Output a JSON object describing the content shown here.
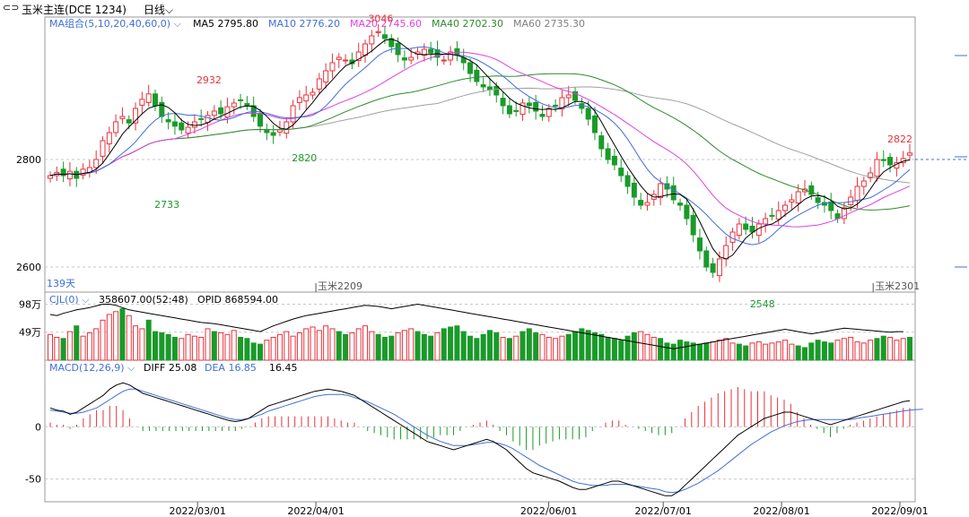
{
  "header": {
    "compare_icon": "compare-icon",
    "symbol": "玉米主连(DCE 1234)",
    "period": "日线",
    "period_chevron": "chevron-down-icon"
  },
  "colors": {
    "up": "#e8323c",
    "down": "#1a9a2a",
    "ma5": "#000000",
    "ma10": "#3f6fd8",
    "ma20": "#e040e0",
    "ma40": "#2e8b2e",
    "ma60": "#a0a0a0",
    "diff": "#000000",
    "dea": "#3f6fd8"
  },
  "chart_data": [
    {
      "type": "candlestick",
      "indicator": {
        "label": "MA组合(5,10,20,40,60,0)",
        "chevron": "chevron-down-icon"
      },
      "legend": [
        {
          "name": "MA5",
          "value": "2795.80",
          "color": "#000000"
        },
        {
          "name": "MA10",
          "value": "2776.20",
          "color": "#3f6fd8"
        },
        {
          "name": "MA20",
          "value": "2745.60",
          "color": "#e040e0"
        },
        {
          "name": "MA40",
          "value": "2702.30",
          "color": "#2e8b2e"
        },
        {
          "name": "MA60",
          "value": "2735.30",
          "color": "#808080"
        }
      ],
      "ylim": [
        2560,
        3060
      ],
      "y_ticks": [
        2600,
        2800
      ],
      "reference_line": 2800,
      "days_label": "139天",
      "contract_markers": [
        {
          "label": "玉米2209",
          "date": "2022/04/01"
        },
        {
          "label": "玉米2301",
          "date": "2022/08/25"
        }
      ],
      "annotations": [
        {
          "label": "2932",
          "date": "2022/03/04",
          "value": 2932,
          "kind": "high"
        },
        {
          "label": "3046",
          "date": "2022/04/18",
          "value": 3046,
          "kind": "high"
        },
        {
          "label": "2822",
          "date": "2022/09/01",
          "value": 2822,
          "kind": "high"
        },
        {
          "label": "2733",
          "date": "2022/02/21",
          "value": 2733,
          "kind": "low"
        },
        {
          "label": "2820",
          "date": "2022/03/29",
          "value": 2820,
          "kind": "low"
        },
        {
          "label": "2548",
          "date": "2022/07/27",
          "value": 2548,
          "kind": "low"
        }
      ],
      "close_path": [
        2770,
        2776,
        2770,
        2778,
        2765,
        2782,
        2785,
        2800,
        2835,
        2850,
        2870,
        2880,
        2868,
        2895,
        2912,
        2922,
        2900,
        2880,
        2870,
        2862,
        2855,
        2860,
        2870,
        2875,
        2882,
        2890,
        2885,
        2898,
        2905,
        2910,
        2900,
        2880,
        2862,
        2850,
        2845,
        2855,
        2870,
        2900,
        2915,
        2920,
        2925,
        2950,
        2965,
        2980,
        2990,
        2985,
        2978,
        3000,
        3015,
        3030,
        3038,
        3025,
        3010,
        2995,
        2985,
        2990,
        3000,
        3005,
        2998,
        2990,
        2985,
        3000,
        2995,
        2980,
        2960,
        2945,
        2935,
        2930,
        2920,
        2900,
        2885,
        2890,
        2905,
        2900,
        2890,
        2880,
        2895,
        2900,
        2915,
        2920,
        2910,
        2895,
        2875,
        2850,
        2820,
        2800,
        2790,
        2770,
        2750,
        2730,
        2715,
        2720,
        2735,
        2755,
        2745,
        2725,
        2715,
        2690,
        2660,
        2630,
        2600,
        2590,
        2615,
        2640,
        2665,
        2680,
        2670,
        2665,
        2680,
        2690,
        2695,
        2705,
        2715,
        2725,
        2740,
        2745,
        2735,
        2720,
        2715,
        2705,
        2690,
        2710,
        2730,
        2750,
        2760,
        2775,
        2800,
        2798,
        2790,
        2794,
        2802,
        2812
      ]
    },
    {
      "type": "bar",
      "indicator": {
        "label": "CJL(0)",
        "chevron": "chevron-down-icon"
      },
      "legend": [
        {
          "name": "CJL",
          "value": "358607.00(52:48)"
        },
        {
          "name": "OPID",
          "value": "868594.00"
        }
      ],
      "y_ticks": [
        {
          "label": "98万",
          "value": 98
        },
        {
          "label": "49万",
          "value": 49
        }
      ],
      "unit": "万",
      "values": [
        45,
        40,
        38,
        50,
        60,
        42,
        48,
        55,
        70,
        80,
        85,
        90,
        78,
        60,
        55,
        70,
        50,
        48,
        45,
        40,
        38,
        45,
        42,
        40,
        55,
        50,
        48,
        45,
        52,
        40,
        38,
        30,
        28,
        35,
        40,
        45,
        50,
        42,
        48,
        55,
        58,
        52,
        60,
        55,
        50,
        45,
        48,
        55,
        60,
        50,
        45,
        40,
        42,
        48,
        52,
        55,
        50,
        45,
        42,
        48,
        55,
        58,
        60,
        50,
        42,
        38,
        45,
        52,
        48,
        40,
        38,
        42,
        50,
        55,
        48,
        45,
        40,
        38,
        42,
        45,
        50,
        55,
        52,
        48,
        45,
        40,
        38,
        35,
        42,
        48,
        50,
        45,
        40,
        38,
        30,
        28,
        35,
        32,
        30,
        28,
        30,
        32,
        35,
        38,
        30,
        28,
        25,
        30,
        32,
        28,
        30,
        32,
        35,
        28,
        25,
        22,
        30,
        35,
        32,
        30,
        35,
        38,
        40,
        32,
        30,
        35,
        38,
        42,
        40,
        35,
        38,
        40
      ],
      "oi_path": [
        80,
        78,
        82,
        85,
        88,
        90,
        92,
        95,
        98,
        98,
        96,
        92,
        88,
        86,
        84,
        82,
        80,
        78,
        76,
        74,
        72,
        70,
        68,
        66,
        65,
        64,
        62,
        60,
        58,
        56,
        54,
        52,
        50,
        55,
        60,
        64,
        68,
        72,
        75,
        78,
        80,
        82,
        84,
        86,
        88,
        90,
        92,
        94,
        96,
        95,
        94,
        92,
        90,
        92,
        94,
        96,
        98,
        96,
        94,
        92,
        90,
        88,
        86,
        84,
        82,
        80,
        78,
        76,
        74,
        72,
        70,
        68,
        66,
        64,
        62,
        60,
        58,
        56,
        54,
        52,
        50,
        48,
        46,
        44,
        42,
        40,
        38,
        36,
        34,
        32,
        30,
        28,
        26,
        24,
        22,
        20,
        22,
        24,
        26,
        28,
        30,
        32,
        34,
        36,
        38,
        40,
        42,
        44,
        46,
        48,
        50,
        52,
        54,
        52,
        50,
        48,
        46,
        48,
        50,
        52,
        54,
        56,
        55,
        54,
        53,
        52,
        51,
        50,
        49,
        50,
        50
      ],
      "up_flags": [
        1,
        1,
        0,
        1,
        0,
        1,
        1,
        1,
        1,
        1,
        1,
        0,
        1,
        1,
        1,
        0,
        0,
        0,
        0,
        0,
        1,
        1,
        1,
        1,
        1,
        0,
        1,
        1,
        1,
        0,
        0,
        0,
        0,
        1,
        1,
        1,
        1,
        1,
        1,
        1,
        1,
        1,
        1,
        1,
        0,
        0,
        1,
        1,
        1,
        1,
        0,
        0,
        0,
        1,
        1,
        1,
        0,
        0,
        0,
        1,
        0,
        0,
        0,
        0,
        0,
        0,
        0,
        0,
        0,
        1,
        0,
        1,
        0,
        0,
        0,
        1,
        1,
        1,
        1,
        0,
        0,
        0,
        0,
        0,
        0,
        0,
        0,
        0,
        0,
        0,
        1,
        1,
        1,
        0,
        0,
        0,
        0,
        0,
        0,
        0,
        0,
        1,
        1,
        1,
        1,
        0,
        0,
        1,
        1,
        1,
        1,
        1,
        1,
        1,
        0,
        0,
        0,
        0,
        0,
        0,
        1,
        1,
        1,
        1,
        1,
        1,
        0,
        0,
        1,
        1,
        1
      ]
    },
    {
      "type": "line",
      "indicator": {
        "label": "MACD(12,26,9)",
        "chevron": "chevron-down-icon"
      },
      "legend": [
        {
          "name": "DIFF",
          "value": "25.08"
        },
        {
          "name": "DEA",
          "value": "16.85"
        },
        {
          "name": "MACD",
          "value": "16.45"
        }
      ],
      "y_ticks": [
        0,
        -50
      ],
      "ylim": [
        -70,
        50
      ],
      "diff": [
        18,
        16,
        15,
        12,
        14,
        18,
        22,
        26,
        30,
        36,
        40,
        42,
        40,
        36,
        32,
        30,
        28,
        26,
        24,
        22,
        20,
        18,
        16,
        14,
        12,
        10,
        8,
        6,
        5,
        6,
        8,
        12,
        16,
        20,
        22,
        24,
        26,
        28,
        30,
        32,
        34,
        35,
        36,
        35,
        34,
        32,
        30,
        26,
        22,
        18,
        14,
        10,
        6,
        2,
        -2,
        -6,
        -10,
        -14,
        -16,
        -18,
        -20,
        -22,
        -20,
        -18,
        -16,
        -14,
        -12,
        -14,
        -18,
        -22,
        -28,
        -34,
        -40,
        -44,
        -46,
        -48,
        -50,
        -52,
        -55,
        -58,
        -60,
        -60,
        -58,
        -56,
        -54,
        -52,
        -52,
        -54,
        -56,
        -58,
        -60,
        -62,
        -64,
        -66,
        -66,
        -62,
        -56,
        -50,
        -44,
        -38,
        -32,
        -26,
        -20,
        -14,
        -8,
        -4,
        0,
        4,
        8,
        10,
        12,
        14,
        14,
        12,
        10,
        8,
        6,
        4,
        2,
        4,
        6,
        8,
        10,
        12,
        14,
        16,
        18,
        20,
        22,
        24,
        25
      ],
      "dea": [
        16,
        15,
        14,
        13,
        13,
        14,
        16,
        18,
        22,
        26,
        30,
        34,
        36,
        36,
        34,
        32,
        30,
        28,
        26,
        24,
        22,
        20,
        18,
        16,
        14,
        12,
        10,
        8,
        7,
        7,
        8,
        10,
        12,
        15,
        17,
        19,
        21,
        23,
        25,
        27,
        29,
        30,
        31,
        31,
        31,
        30,
        28,
        26,
        24,
        21,
        18,
        15,
        12,
        8,
        4,
        0,
        -4,
        -8,
        -11,
        -14,
        -16,
        -18,
        -18,
        -18,
        -17,
        -16,
        -15,
        -15,
        -16,
        -18,
        -21,
        -25,
        -29,
        -33,
        -37,
        -40,
        -43,
        -46,
        -49,
        -52,
        -54,
        -55,
        -56,
        -56,
        -56,
        -55,
        -55,
        -55,
        -56,
        -57,
        -58,
        -59,
        -60,
        -62,
        -63,
        -62,
        -60,
        -57,
        -54,
        -50,
        -46,
        -42,
        -37,
        -32,
        -27,
        -22,
        -17,
        -13,
        -9,
        -5,
        -2,
        1,
        3,
        5,
        6,
        7,
        7,
        7,
        7,
        7,
        7,
        7,
        8,
        9,
        10,
        11,
        12,
        13,
        14,
        15,
        16,
        16.5,
        16.85
      ],
      "hist_sign": "DIFF-DEA"
    }
  ],
  "x_axis": {
    "labels": [
      "2022/03/01",
      "2022/04/01",
      "2022/06/01",
      "2022/07/01",
      "2022/08/01",
      "2022/09/01"
    ]
  }
}
